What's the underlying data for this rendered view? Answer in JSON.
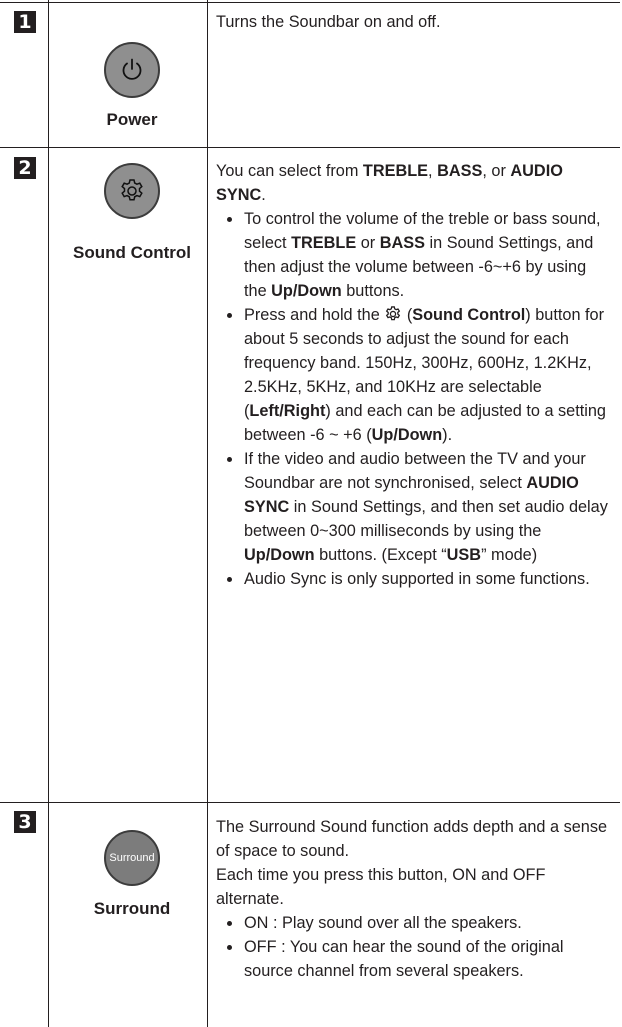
{
  "rows": [
    {
      "number": "1",
      "icon": "power-icon",
      "label": "Power",
      "description": "Turns the Soundbar on and off."
    },
    {
      "number": "2",
      "icon": "gear-icon",
      "label": "Sound Control",
      "intro": {
        "t1": "You can select from ",
        "b1": "TREBLE",
        "t2": ", ",
        "b2": "BASS",
        "t3": ", or ",
        "b3": "AUDIO SYNC",
        "t4": "."
      },
      "bullets": [
        {
          "t1": "To control the volume of the treble or bass sound, select ",
          "b1": "TREBLE",
          "t2": " or ",
          "b2": "BASS",
          "t3": " in Sound Settings, and then adjust the volume between -6~+6 by using the ",
          "b3": "Up/Down",
          "t4": " buttons."
        },
        {
          "t1": "Press and hold the ",
          "t2": " (",
          "b1": "Sound Control",
          "t3": ") button for about 5 seconds to adjust the sound for each frequency band. 150Hz, 300Hz, 600Hz, 1.2KHz, 2.5KHz, 5KHz, and 10KHz are selectable (",
          "b2": "Left/Right",
          "t4": ") and each can be adjusted to a setting between -6 ~ +6 (",
          "b3": "Up/Down",
          "t5": ")."
        },
        {
          "t1": "If the video and audio between the TV and your Soundbar are not synchronised, select ",
          "b1": "AUDIO SYNC",
          "t2": " in Sound Settings, and then set audio delay between 0~300 milliseconds by using the ",
          "b2": "Up/Down",
          "t3": " buttons. (Except “",
          "b3": "USB",
          "t4": "” mode)"
        },
        {
          "t1": "Audio Sync is only supported in some functions."
        }
      ]
    },
    {
      "number": "3",
      "icon_text": "Surround",
      "label": "Surround",
      "p1": "The Surround Sound function adds depth and a sense of space to sound.",
      "p2": "Each time you press this button, ON and OFF alternate.",
      "bullets": [
        "ON : Play sound over all the speakers.",
        "OFF : You can hear the sound of the original source channel from several speakers."
      ]
    }
  ]
}
